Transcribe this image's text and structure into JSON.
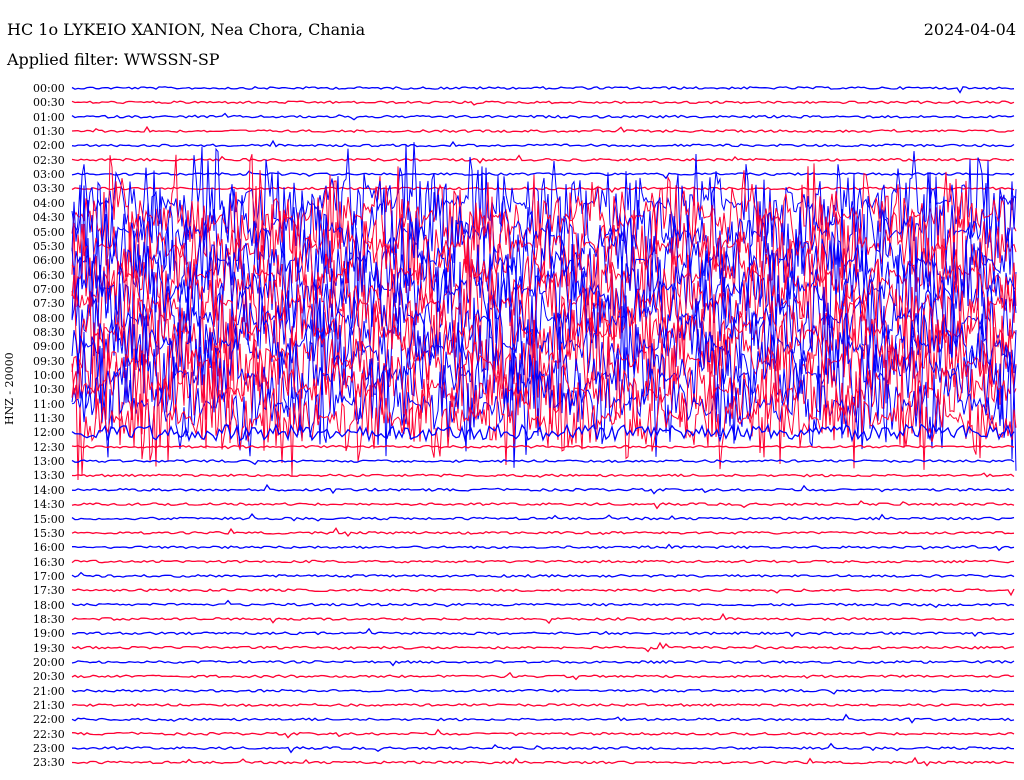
{
  "header": {
    "station": "HC 1o LYKEIO XANION, Nea Chora, Chania",
    "date": "2024-04-04",
    "filter": "Applied filter: WWSSN-SP"
  },
  "chart_data": {
    "type": "line",
    "title": "HC 1o LYKEIO XANION, Nea Chora, Chania",
    "ylabel": "HNZ - 20000",
    "tick_labels": [
      "00:00",
      "00:30",
      "01:00",
      "01:30",
      "02:00",
      "02:30",
      "03:00",
      "03:30",
      "04:00",
      "04:30",
      "05:00",
      "05:30",
      "06:00",
      "06:30",
      "07:00",
      "07:30",
      "08:00",
      "08:30",
      "09:00",
      "09:30",
      "10:00",
      "10:30",
      "11:00",
      "11:30",
      "12:00",
      "12:30",
      "13:00",
      "13:30",
      "14:00",
      "14:30",
      "15:00",
      "15:30",
      "16:00",
      "16:30",
      "17:00",
      "17:30",
      "18:00",
      "18:30",
      "19:00",
      "19:30",
      "20:00",
      "20:30",
      "21:00",
      "21:30",
      "22:00",
      "22:30",
      "23:00",
      "23:30"
    ],
    "colors": {
      "even": "#0000ff",
      "odd": "#ff0033"
    },
    "series": [
      {
        "rows": [
          0,
          1,
          2,
          3,
          4,
          5,
          6,
          7
        ],
        "activity": "quiet"
      },
      {
        "rows": [
          8,
          9,
          10,
          11,
          12,
          13,
          14,
          15,
          16,
          17,
          18,
          19,
          20,
          21,
          22,
          23
        ],
        "activity": "high"
      },
      {
        "rows": [
          24
        ],
        "activity": "moderate"
      },
      {
        "rows": [
          25,
          26,
          27,
          28,
          29,
          30,
          31,
          32,
          33,
          34,
          35,
          36,
          37,
          38,
          39,
          40,
          41,
          42,
          43,
          44,
          45,
          46,
          47
        ],
        "activity": "quiet"
      }
    ],
    "grid": false
  }
}
